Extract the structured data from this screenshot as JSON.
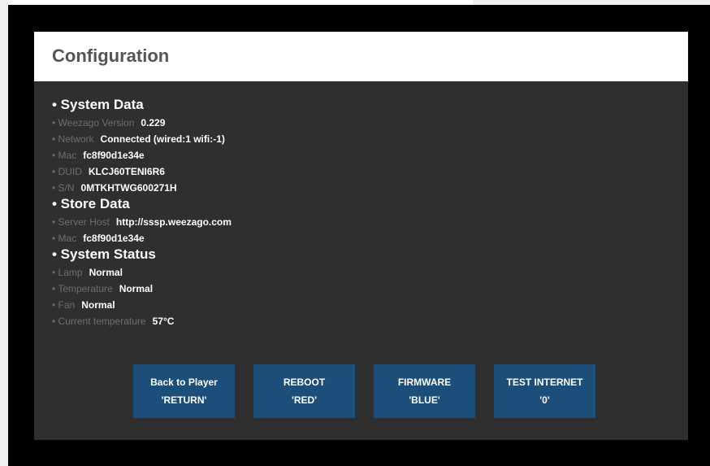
{
  "panel": {
    "title": "Configuration"
  },
  "system_data": {
    "heading": "• System Data",
    "rows": [
      {
        "label": "• Weezago Version",
        "value": "0.229"
      },
      {
        "label": "• Network",
        "value": "Connected (wired:1 wifi:-1)"
      },
      {
        "label": "• Mac",
        "value": "fc8f90d1e34e"
      },
      {
        "label": "• DUID",
        "value": "KLCJ60TENI6R6"
      },
      {
        "label": "• S/N",
        "value": "0MTKHTWG600271H"
      }
    ]
  },
  "store_data": {
    "heading": "• Store Data",
    "rows": [
      {
        "label": "• Server Host",
        "value": "http://sssp.weezago.com"
      },
      {
        "label": "• Mac",
        "value": "fc8f90d1e34e"
      }
    ]
  },
  "system_status": {
    "heading": "• System Status",
    "rows": [
      {
        "label": "• Lamp",
        "value": "Normal"
      },
      {
        "label": "• Temperature",
        "value": "Normal"
      },
      {
        "label": "• Fan",
        "value": "Normal"
      },
      {
        "label": "• Current temperature",
        "value": "57°C"
      }
    ]
  },
  "buttons": [
    {
      "line1": "Back to Player",
      "line2": "'RETURN'"
    },
    {
      "line1": "REBOOT",
      "line2": "'RED'"
    },
    {
      "line1": "FIRMWARE",
      "line2": "'BLUE'"
    },
    {
      "line1": "TEST INTERNET",
      "line2": "'0'"
    }
  ],
  "colors": {
    "panel_bg": "#2f2f2f",
    "header_bg": "#ffffff",
    "button_bg": "#1b4f7a",
    "label_gray": "#6e6e6e"
  }
}
